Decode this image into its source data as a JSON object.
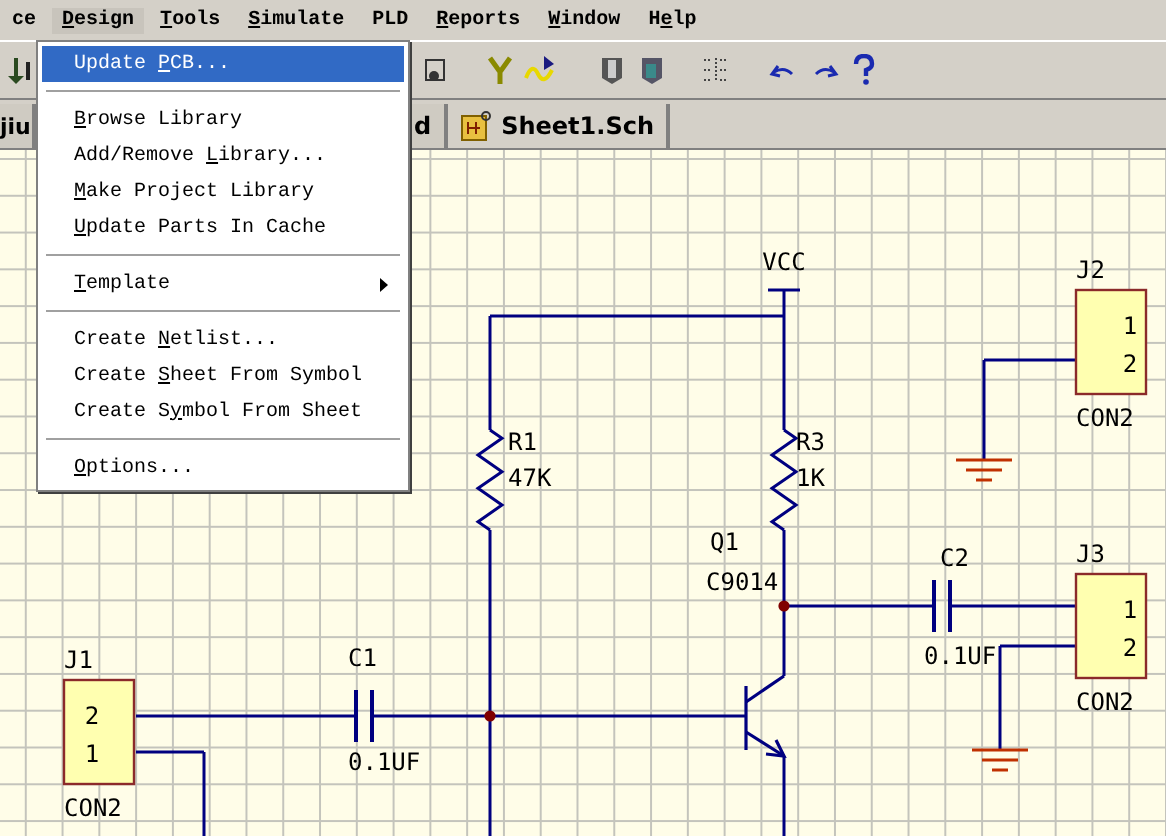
{
  "menu_bar": [
    {
      "before": "ce",
      "selected": false
    },
    {
      "key": "D",
      "after": "esign",
      "selected": true
    },
    {
      "key": "T",
      "after": "ools",
      "selected": false
    },
    {
      "key": "S",
      "after": "imulate",
      "selected": false
    },
    {
      "before": "PLD",
      "selected": false
    },
    {
      "key": "R",
      "after": "eports",
      "selected": false
    },
    {
      "key": "W",
      "after": "indow",
      "selected": false
    },
    {
      "before": "H",
      "key": "e",
      "after": "lp",
      "selected": false
    }
  ],
  "design_menu": [
    {
      "kind": "item",
      "before": "Update ",
      "key": "P",
      "after": "CB...",
      "selected": true
    },
    {
      "kind": "separator"
    },
    {
      "kind": "item",
      "key": "B",
      "after": "rowse Library",
      "selected": false
    },
    {
      "kind": "item",
      "before": "Add/Remove ",
      "key": "L",
      "after": "ibrary...",
      "selected": false
    },
    {
      "kind": "item",
      "key": "M",
      "after": "ake Project Library",
      "selected": false
    },
    {
      "kind": "item",
      "key": "U",
      "after": "pdate Parts In Cache",
      "selected": false
    },
    {
      "kind": "separator"
    },
    {
      "kind": "submenu",
      "key": "T",
      "after": "emplate",
      "selected": false
    },
    {
      "kind": "separator"
    },
    {
      "kind": "item",
      "before": "Create ",
      "key": "N",
      "after": "etlist...",
      "selected": false
    },
    {
      "kind": "item",
      "before": "Create ",
      "key": "S",
      "after": "heet From Symbol",
      "selected": false
    },
    {
      "kind": "item",
      "before": "Create S",
      "key": "y",
      "after": "mbol From Sheet",
      "selected": false
    },
    {
      "kind": "separator"
    },
    {
      "kind": "item",
      "key": "O",
      "after": "ptions...",
      "selected": false
    }
  ],
  "tabs": [
    {
      "label": "jiu",
      "selected": false
    },
    {
      "label": "d",
      "selected": false
    },
    {
      "label": "Sheet1.Sch",
      "selected": true
    }
  ],
  "schematic": {
    "parts": [
      {
        "kind": "power",
        "ref": "VCC"
      },
      {
        "kind": "resistor",
        "ref": "R1",
        "value": "47K"
      },
      {
        "kind": "resistor",
        "ref": "R3",
        "value": "1K"
      },
      {
        "kind": "transistor",
        "ref": "Q1",
        "value": "C9014"
      },
      {
        "kind": "capacitor",
        "ref": "C1",
        "value": "0.1UF"
      },
      {
        "kind": "capacitor",
        "ref": "C2",
        "value": "0.1UF"
      },
      {
        "kind": "connector",
        "ref": "J1",
        "value": "CON2",
        "pins": [
          "2",
          "1"
        ]
      },
      {
        "kind": "connector",
        "ref": "J2",
        "value": "CON2",
        "pins": [
          "1",
          "2"
        ]
      },
      {
        "kind": "connector",
        "ref": "J3",
        "value": "CON2",
        "pins": [
          "1",
          "2"
        ]
      }
    ]
  }
}
